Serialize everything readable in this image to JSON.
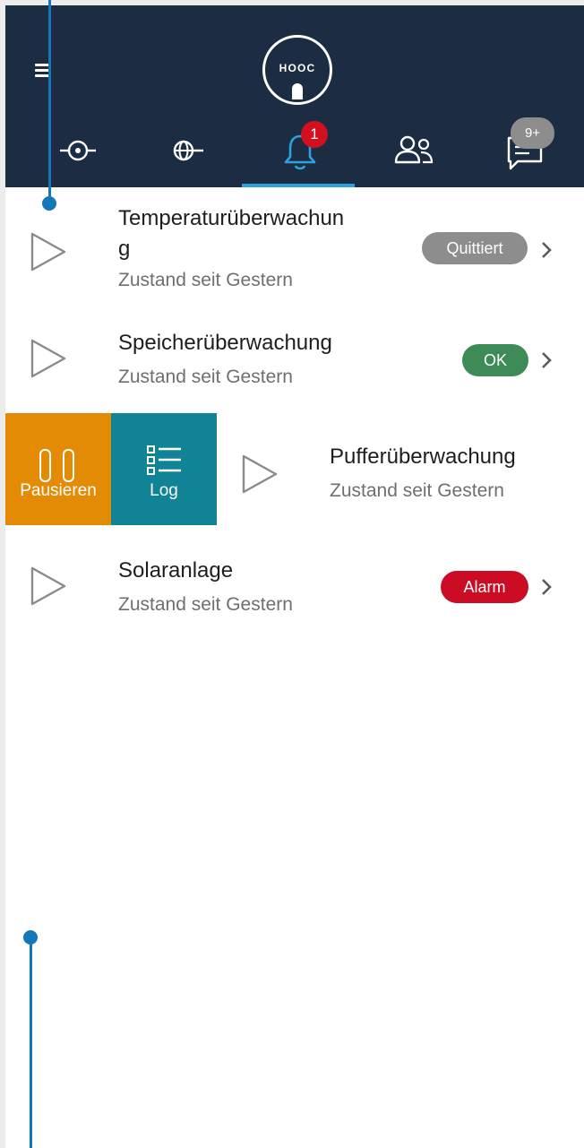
{
  "header": {
    "logo_text": "HOOC",
    "tabs": [
      {
        "name": "nodes-tab",
        "icon": "node-connection-icon"
      },
      {
        "name": "network-tab",
        "icon": "globe-connection-icon"
      },
      {
        "name": "alarms-tab",
        "icon": "bell-icon",
        "active": true,
        "badge": "1"
      },
      {
        "name": "users-tab",
        "icon": "users-icon"
      },
      {
        "name": "messages-tab",
        "icon": "chat-icon",
        "badge": "9+"
      }
    ],
    "alarm_badge": "1",
    "messages_badge": "9+"
  },
  "rows": [
    {
      "title_line1": "Temperaturüberwachun",
      "title_line2": "g",
      "subtitle": "Zustand seit Gestern",
      "status": "Quittiert",
      "status_color": "#8d8d8d"
    },
    {
      "title": "Speicherüberwachung",
      "subtitle": "Zustand seit Gestern",
      "status": "OK",
      "status_color": "#3d8c58"
    },
    {
      "title": "Pufferüberwachung",
      "subtitle": "Zustand seit Gestern"
    },
    {
      "title": "Solaranlage",
      "subtitle": "Zustand seit Gestern",
      "status": "Alarm",
      "status_color": "#cb0c24"
    }
  ],
  "swipe_actions": {
    "pause_label": "Pausieren",
    "pause_color": "#e48b05",
    "log_label": "Log",
    "log_color": "#118397"
  },
  "colors": {
    "header_bg": "#1c2d43",
    "tab_active": "#2aa2df",
    "badge_red": "#d3101f",
    "annotation": "#1477b8"
  }
}
